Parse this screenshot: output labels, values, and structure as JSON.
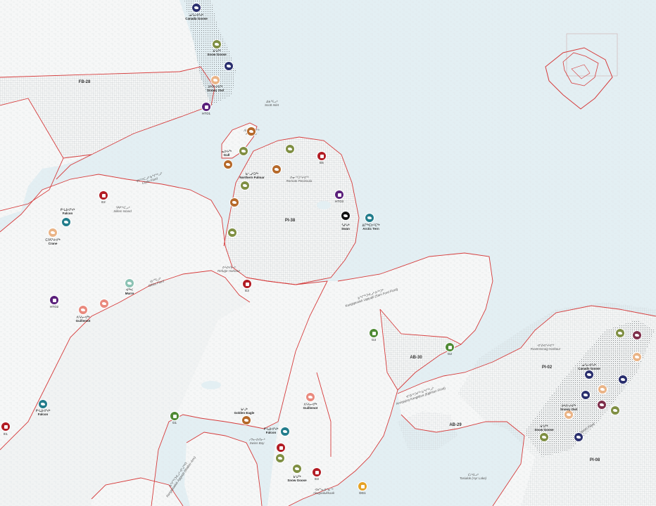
{
  "colors": {
    "water": "#e3eff3",
    "land": "#f6f7f7",
    "boundary": "#d63b3b",
    "brown": "#b5692a",
    "olive": "#7f8f43",
    "navy": "#2a2f6e",
    "purple": "#5a1f7a",
    "red": "#b21c24",
    "teal": "#237d8c",
    "peach": "#eab487",
    "salmon": "#e98a7e",
    "mint": "#8cc3b4",
    "green": "#4f8a34",
    "orange": "#e5a225",
    "maroon": "#7e2f4b",
    "black": "#111111"
  },
  "areas": {
    "fb28": "FB-28",
    "pi38": "PI-38",
    "ab30": "AB-30",
    "ab29": "AB-29",
    "pi02": "PI-02",
    "pi08": "PI-08"
  },
  "codes": {
    "hto1": "HTO1",
    "hto2": "HTO2",
    "hto3": "HTO3",
    "e1": "E1",
    "e2": "E2",
    "e3": "E3",
    "e3b": "E3",
    "e5": "E5",
    "g1": "G1",
    "g2": "G2",
    "g3": "G3",
    "dg1": "DG1"
  },
  "species": {
    "canada_goose_a": {
      "syll": "ᓂᕐᓕᐊᕐᔪᒃ",
      "name": "Canada Goose"
    },
    "snow_goose_a": {
      "syll": "ᑲᖑᖅ",
      "name": "Snow Goose"
    },
    "snowy_owl_a": {
      "syll": "ᐅᒃᐱᒡᔪᐊᖅ",
      "name": "Snowy Owl"
    },
    "gull": {
      "syll": "ᓇᐅᔭᖅ",
      "name": "Gull"
    },
    "northern_fulmar": {
      "syll": "ᑲᓪᓗᒃᑐᖅ",
      "name": "Northern Fulmar"
    },
    "swan": {
      "syll": "ᖁᕐᔪᒃ",
      "name": "Swan"
    },
    "arctic_tern": {
      "syll": "ᐃᒥᖅᑕᐅᑦᑕᖅ",
      "name": "Arctic Tern"
    },
    "falcon_a": {
      "syll": "ᑭᒡᒐᕕᐊᕐᔪᒃ",
      "name": "Falcon"
    },
    "crane": {
      "syll": "ᑕᑎᕋᕐᔪᐊᖅ",
      "name": "Crane"
    },
    "murre": {
      "syll": "ᐊᖅᐸ",
      "name": "Murre"
    },
    "guillemot_a": {
      "syll": "ᐱᑦᓯᓕᐊᖅ",
      "name": "Guillemot"
    },
    "falcon_b": {
      "syll": "ᑭᒡᒐᕕᐊᕐᔪᒃ",
      "name": "Falcon"
    },
    "golden_eagle": {
      "syll": "ᑲᒡᒍᒃ",
      "name": "Golden Eagle"
    },
    "falcon_c": {
      "syll": "ᑭᒡᒐᕕᐊᕐᔪᒃ",
      "name": "Falcon"
    },
    "guillemot_b": {
      "syll": "ᐱᑦᓯᓕᐊᖅ",
      "name": "Guillemot"
    },
    "snow_goose_b": {
      "syll": "ᑲᖑᖅ",
      "name": "Snow Goose"
    },
    "canada_goose_b": {
      "syll": "ᓂᕐᓕᐊᕐᔪᒃ",
      "name": "Canada Goose"
    },
    "snowy_owl_b": {
      "syll": "ᐅᒃᐱᒡᔪᐊᖅ",
      "name": "Snowy Owl"
    },
    "snow_goose_c": {
      "syll": "ᑲᖑᖅ",
      "name": "Snow Goose"
    }
  },
  "places": {
    "scott_inlet": {
      "syll": "ᐃᑲᕐᕋᓗᒃ",
      "name": "Scott Inlet"
    },
    "plateau": {
      "syll": "ᐱᑎᓛᕐᔪᐊᖅ",
      "name": "Plateau"
    },
    "remote_peninsula": {
      "syll": "ᐅᓂᖅᑐᕐᔪᐊᖅ",
      "name": "Remote Peninsula"
    },
    "clyde_fiord": {
      "syll": "ᕿᒋᖅᑕᓗᒃ ᑲᖏᖅᓗᒃ",
      "name": "Clyde Fiord"
    },
    "sillem_island": {
      "syll": "ᕿᑭᖅᑕᓗᒃ",
      "name": "Sillem Island"
    },
    "gibbs_fiord": {
      "syll": "ᐊᓯᕐᕋᓗᒃ",
      "name": "Gibbs Fiord"
    },
    "refuge_harbour": {
      "syll": "ᐅᓴᐅᑎᓕᒃ",
      "name": "Refuge Harbour"
    },
    "kangiqtualuk": {
      "syll": "ᑲᖏᖅᑐᐊᓗᒃ ᐅᖅᑐᒃ",
      "name": "Kangiqtualuk Uqquqti (Sam Ford Fiord)"
    },
    "ravenscraig": {
      "syll": "ᐊᕐᕕᐊᕐᔪᐊᖅ",
      "name": "Ravenscraig Harbour"
    },
    "arviqtujuq": {
      "syll": "ᐊᕐᕕᖅᑐᔪᖅ ᑲᖏᖅᓗᒃ",
      "name": "Arviqtujuq Kangiqtua (Eglinton Fiord)"
    },
    "swiss_bay": {
      "syll": "ᓯᕗᓕᐅᑎᓕᒃ",
      "name": "Swiss Bay"
    },
    "kangiqtualuk_agguqti": {
      "syll": "ᑲᖏᖅᑐᐊᓗᒃ ᐊᒡᒍᖅᑎ",
      "name": "Kangiqtualuk Agguqti (Walker Arm)"
    },
    "akugaalukkaak": {
      "syll": "ᐊᑯᓐᓇᐃᓐᓇᖅ",
      "name": "Akugaalukkaak"
    },
    "tasialuk": {
      "syll": "ᑕᓯᐊᓗᒃ",
      "name": "Tasialuk (Ayr Lake)"
    },
    "inugsuin_fiord": {
      "syll": "",
      "name": "Inugsuin Fiord"
    }
  }
}
